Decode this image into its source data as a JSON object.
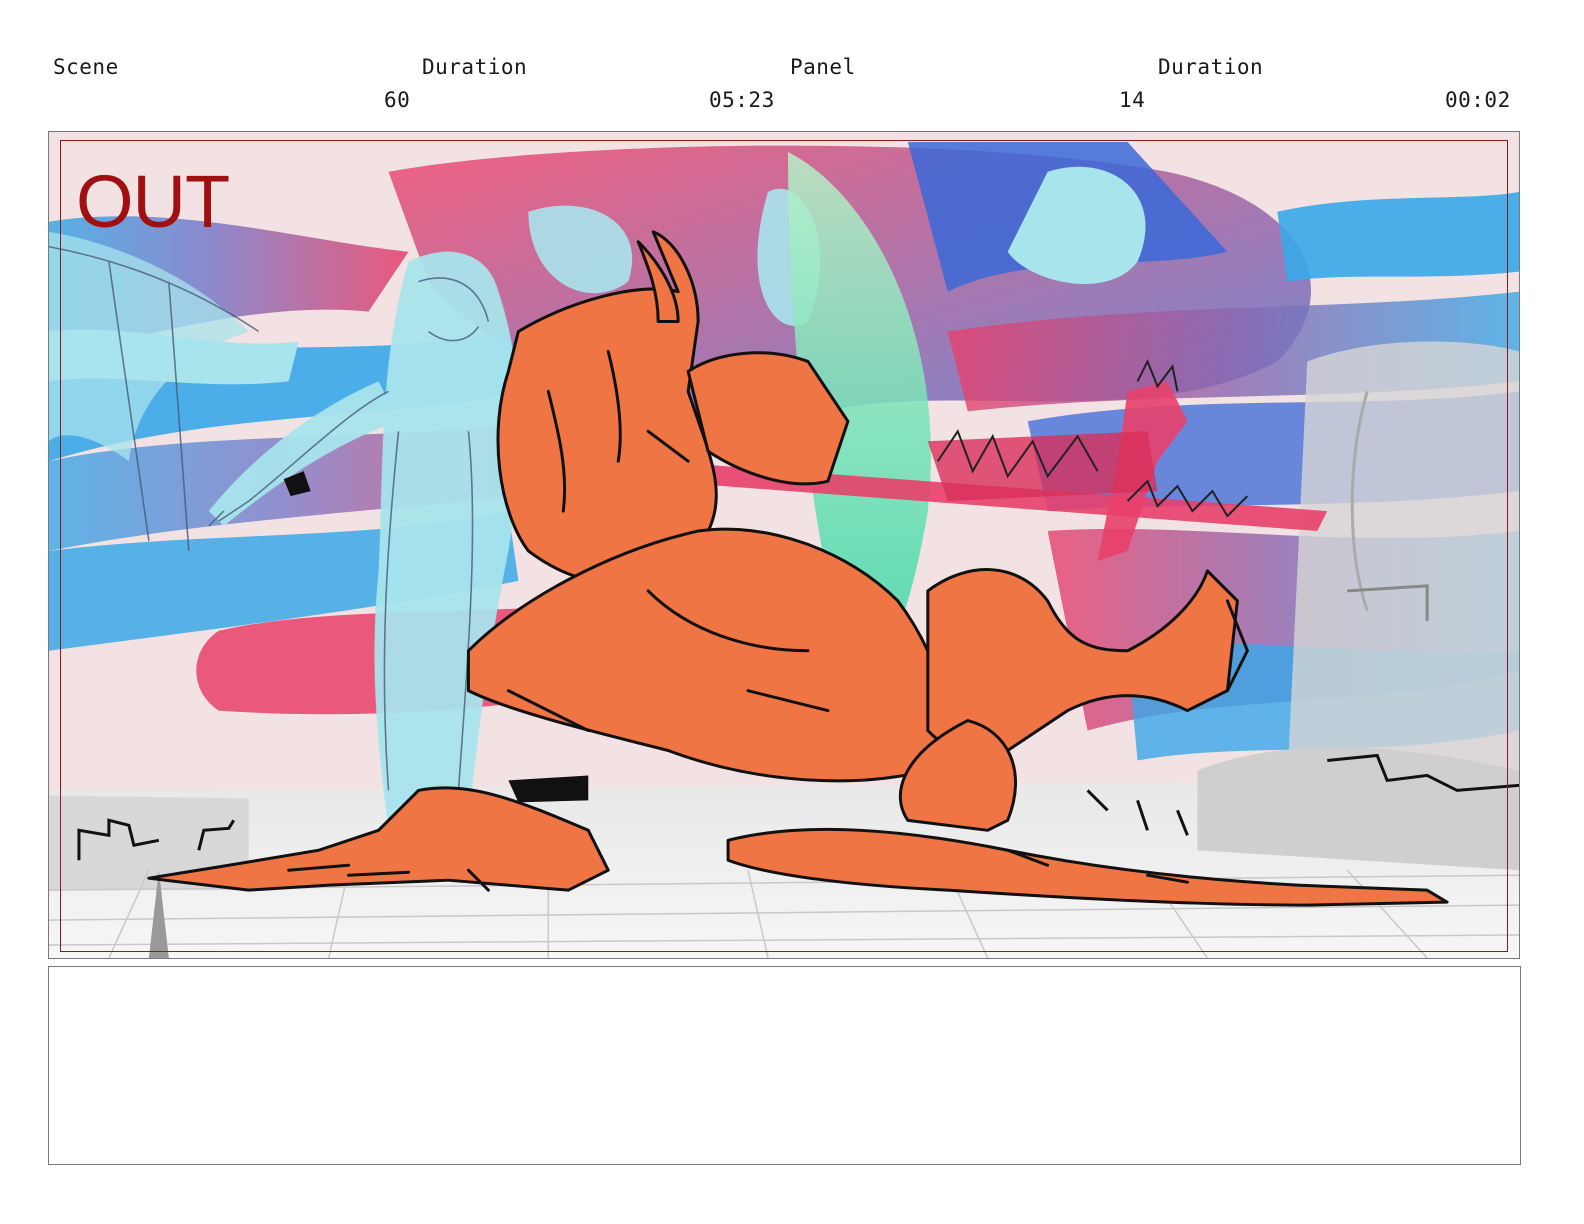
{
  "header": {
    "scene_label": "Scene",
    "scene_duration_label": "Duration",
    "panel_label": "Panel",
    "panel_duration_label": "Duration",
    "scene_number": "60",
    "scene_duration": "05:23",
    "panel_number": "14",
    "panel_duration": "00:02"
  },
  "frame": {
    "overlay_text": "OUT",
    "colors": {
      "character_fill": "#f07545",
      "safe_frame": "#8b1a1a",
      "overlay_text": "#a01010",
      "sky_blue": "#3aa8e8",
      "sky_cyan": "#a8e4ec",
      "streak_red": "#e8406a",
      "streak_purple": "#6a5aa8",
      "glow_green": "#4ee8b0"
    },
    "illustration_icon": "storyboard-drawing"
  },
  "notes": {
    "text": ""
  }
}
